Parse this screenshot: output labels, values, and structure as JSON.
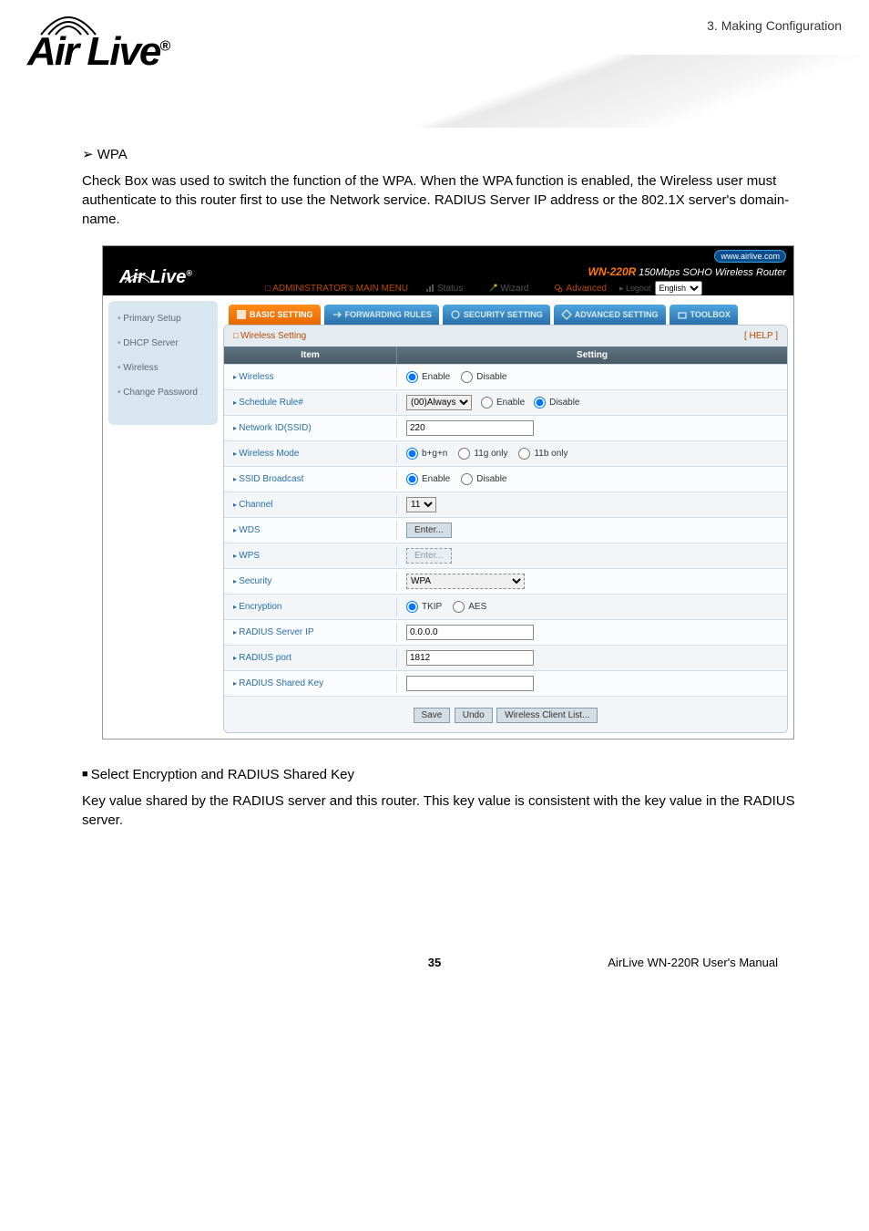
{
  "doc_header": "3. Making Configuration",
  "logo_main": "Air Live",
  "logo_reg": "®",
  "section_heading": "WPA",
  "intro_text": "Check Box was used to switch the function of the WPA. When the WPA function is enabled, the Wireless user must authenticate to this router first to use the Network service. RADIUS Server IP address or the 802.1X server's domain-name.",
  "screenshot": {
    "logo": "Air Live",
    "url_badge": "www.airlive.com",
    "model": "WN-220R",
    "model_desc": "150Mbps SOHO Wireless Router",
    "admin_menu": "□ ADMINISTRATOR's MAIN MENU",
    "menu": {
      "status": "Status",
      "wizard": "Wizard",
      "advanced": "Advanced",
      "logout": "▸ Logout",
      "lang": "English"
    },
    "tabs": [
      "BASIC SETTING",
      "FORWARDING RULES",
      "SECURITY SETTING",
      "ADVANCED SETTING",
      "TOOLBOX"
    ],
    "sidebar": [
      "Primary Setup",
      "DHCP Server",
      "Wireless",
      "Change Password"
    ],
    "panel": {
      "title": "Wireless Setting",
      "help": "[ HELP ]",
      "col_item": "Item",
      "col_setting": "Setting",
      "rows": [
        {
          "label": "Wireless",
          "type": "radio2",
          "opts": [
            "Enable",
            "Disable"
          ],
          "sel": 0
        },
        {
          "label": "Schedule Rule#",
          "type": "schedule",
          "select": "(00)Always",
          "opts": [
            "Enable",
            "Disable"
          ],
          "sel": 1
        },
        {
          "label": "Network ID(SSID)",
          "type": "text",
          "value": "220"
        },
        {
          "label": "Wireless Mode",
          "type": "radio3",
          "opts": [
            "b+g+n",
            "11g only",
            "11b only"
          ],
          "sel": 0
        },
        {
          "label": "SSID Broadcast",
          "type": "radio2",
          "opts": [
            "Enable",
            "Disable"
          ],
          "sel": 0
        },
        {
          "label": "Channel",
          "type": "select",
          "value": "11"
        },
        {
          "label": "WDS",
          "type": "btn",
          "value": "Enter..."
        },
        {
          "label": "WPS",
          "type": "btn-dashed",
          "value": "Enter..."
        },
        {
          "label": "Security",
          "type": "select-dashed",
          "value": "WPA"
        },
        {
          "label": "Encryption",
          "type": "radio2",
          "opts": [
            "TKIP",
            "AES"
          ],
          "sel": 0
        },
        {
          "label": "RADIUS Server IP",
          "type": "text",
          "value": "0.0.0.0"
        },
        {
          "label": "RADIUS port",
          "type": "text",
          "value": "1812"
        },
        {
          "label": "RADIUS Shared Key",
          "type": "text",
          "value": ""
        }
      ],
      "buttons": [
        "Save",
        "Undo",
        "Wireless Client List..."
      ]
    }
  },
  "bullet": "Select Encryption and RADIUS Shared Key",
  "closing": "Key value shared by the RADIUS server and this router. This key value is consistent with the key value in the RADIUS server.",
  "footer": {
    "page": "35",
    "manual": "AirLive WN-220R User's Manual"
  }
}
